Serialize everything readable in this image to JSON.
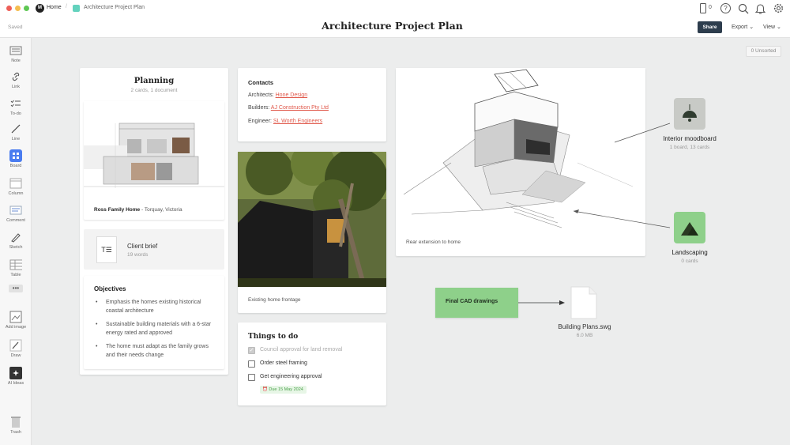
{
  "tab": {
    "home": "Home",
    "doc": "Architecture Project Plan"
  },
  "toolbar": {
    "device_count": "0",
    "share": "Share",
    "export": "Export",
    "view": "View"
  },
  "header": {
    "saved": "Saved",
    "title": "Architecture Project Plan"
  },
  "sidebar": {
    "items": [
      "Note",
      "Link",
      "To-do",
      "Line",
      "Board",
      "Column",
      "Comment",
      "Sketch",
      "Table",
      "Add image",
      "Draw",
      "AI Ideas"
    ],
    "trash": "Trash"
  },
  "unsorted": "0 Unsorted",
  "planning": {
    "title": "Planning",
    "meta": "2 cards, 1 document",
    "caption_bold": "Ross Family Home",
    "caption_rest": " - Torquay, Victoria",
    "brief_title": "Client brief",
    "brief_words": "19 words",
    "objectives_title": "Objectives",
    "objectives": [
      "Emphasis the homes existing historical coastal architecture",
      "Sustainable building materials with a 6-star energy rated and approved",
      "The home must adapt as the family grows and their needs change"
    ]
  },
  "contacts": {
    "title": "Contacts",
    "rows": [
      {
        "label": "Architects: ",
        "link": "Hone Design"
      },
      {
        "label": "Builders: ",
        "link": "AJ Construction Pty Ltd"
      },
      {
        "label": "Engineer: ",
        "link": "SL Worth Engineers"
      }
    ]
  },
  "frontage": {
    "caption": "Existing home frontage"
  },
  "todo": {
    "title": "Things to do",
    "items": [
      {
        "label": "Council approval for land removal",
        "done": true
      },
      {
        "label": "Order steel framing",
        "done": false
      },
      {
        "label": "Get engineering approval",
        "done": false
      }
    ],
    "due": "Due 15 May 2024"
  },
  "rear": {
    "caption": "Rear extension to home"
  },
  "moodboard": {
    "title": "Interior moodboard",
    "meta": "1 board, 13 cards"
  },
  "landscaping": {
    "title": "Landscaping",
    "meta": "0 cards"
  },
  "cad": {
    "label": "Final CAD drawings"
  },
  "file": {
    "name": "Building Plans.swg",
    "size": "6.0 MB"
  },
  "colors": {
    "accent": "#e0584a",
    "green": "#8ed08a",
    "board_blue": "#4a7cf0",
    "dark_btn": "#2d3d4d"
  }
}
